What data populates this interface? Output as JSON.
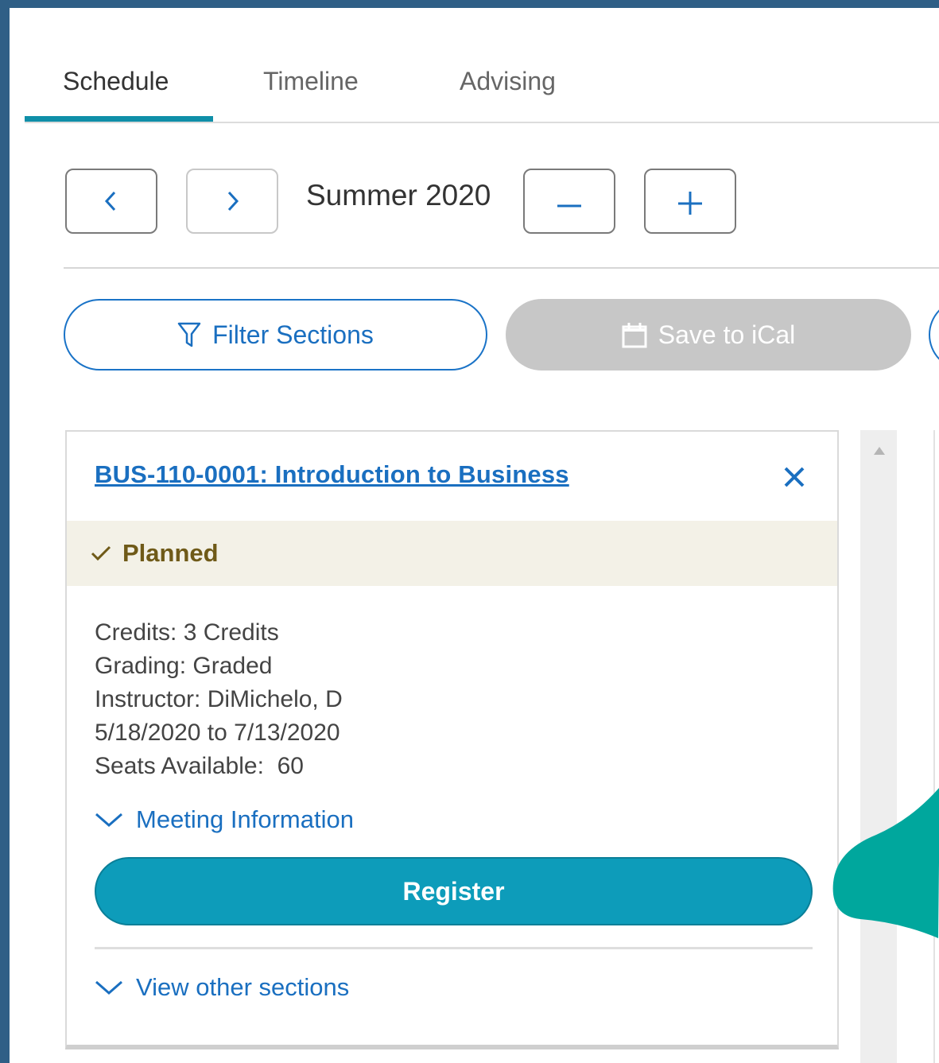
{
  "tabs": [
    {
      "label": "Schedule",
      "active": true
    },
    {
      "label": "Timeline",
      "active": false
    },
    {
      "label": "Advising",
      "active": false
    }
  ],
  "term_nav": {
    "term": "Summer 2020",
    "prev_icon": "chevron-left-icon",
    "next_icon": "chevron-right-icon",
    "remove_icon": "minus-icon",
    "add_icon": "plus-icon"
  },
  "actions": {
    "filter_label": "Filter Sections",
    "filter_icon": "filter-icon",
    "ical_label": "Save to iCal",
    "ical_icon": "calendar-icon"
  },
  "section_card": {
    "title": "BUS-110-0001: Introduction to Business",
    "status": "Planned",
    "details": [
      "Credits: 3 Credits",
      "Grading: Graded",
      "Instructor: DiMichelo, D",
      "5/18/2020 to 7/13/2020",
      "Seats Available:  60"
    ],
    "meeting_info_label": "Meeting Information",
    "register_label": "Register",
    "other_sections_label": "View other sections"
  },
  "colors": {
    "frame": "#2f5f86",
    "accent": "#0f8fa8",
    "link": "#1a6fc0",
    "register": "#0d9cba",
    "status_bg": "#f3f1e7",
    "status_text": "#6f5a18",
    "bubble": "#00a79d"
  }
}
